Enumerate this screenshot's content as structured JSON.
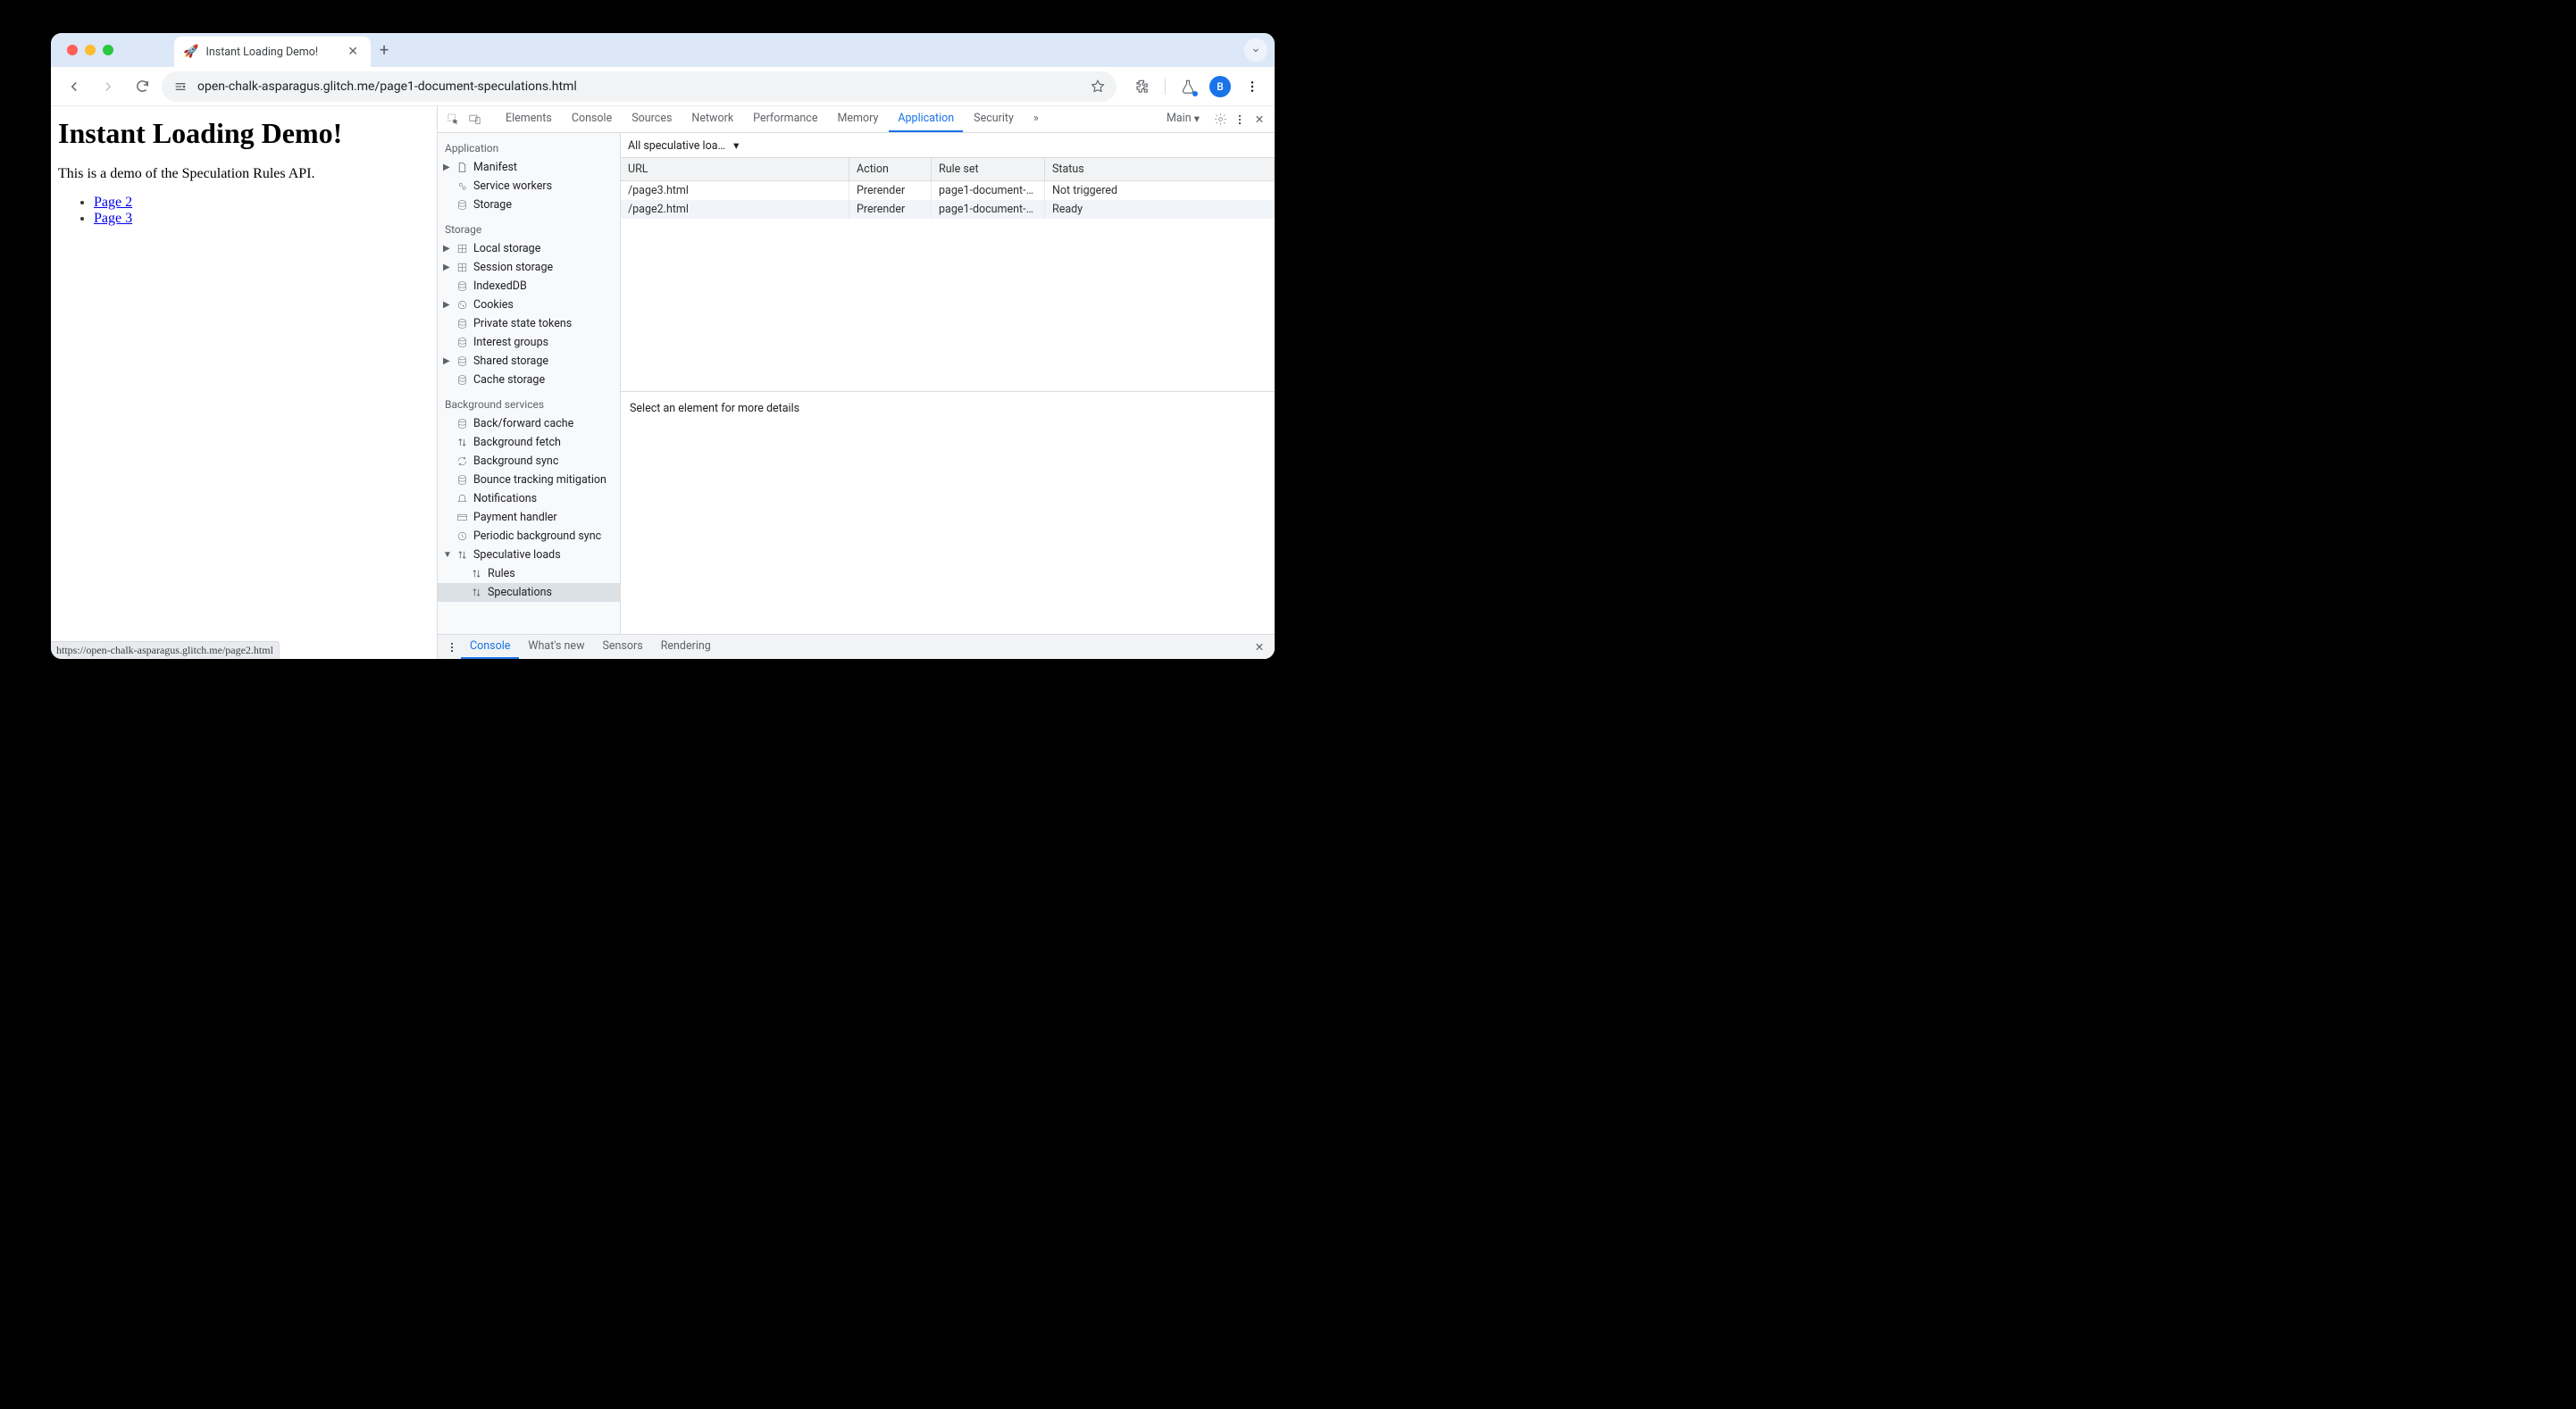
{
  "browser": {
    "tab": {
      "favicon": "🚀",
      "title": "Instant Loading Demo!"
    },
    "url": "open-chalk-asparagus.glitch.me/page1-document-speculations.html",
    "avatar_initial": "B",
    "status_hover": "https://open-chalk-asparagus.glitch.me/page2.html"
  },
  "page": {
    "heading": "Instant Loading Demo!",
    "intro": "This is a demo of the Speculation Rules API.",
    "links": [
      "Page 2",
      "Page 3"
    ]
  },
  "devtools": {
    "tabs": [
      "Elements",
      "Console",
      "Sources",
      "Network",
      "Performance",
      "Memory",
      "Application",
      "Security"
    ],
    "active_tab": "Application",
    "target_label": "Main",
    "sidebar": {
      "sections": [
        {
          "title": "Application",
          "items": [
            {
              "icon": "file",
              "label": "Manifest",
              "chev": true
            },
            {
              "icon": "gears",
              "label": "Service workers"
            },
            {
              "icon": "db",
              "label": "Storage"
            }
          ]
        },
        {
          "title": "Storage",
          "items": [
            {
              "icon": "grid",
              "label": "Local storage",
              "chev": true
            },
            {
              "icon": "grid",
              "label": "Session storage",
              "chev": true
            },
            {
              "icon": "db",
              "label": "IndexedDB"
            },
            {
              "icon": "cookie",
              "label": "Cookies",
              "chev": true
            },
            {
              "icon": "db",
              "label": "Private state tokens"
            },
            {
              "icon": "db",
              "label": "Interest groups"
            },
            {
              "icon": "db",
              "label": "Shared storage",
              "chev": true
            },
            {
              "icon": "db",
              "label": "Cache storage"
            }
          ]
        },
        {
          "title": "Background services",
          "items": [
            {
              "icon": "db",
              "label": "Back/forward cache"
            },
            {
              "icon": "arrows",
              "label": "Background fetch"
            },
            {
              "icon": "sync",
              "label": "Background sync"
            },
            {
              "icon": "db",
              "label": "Bounce tracking mitigation"
            },
            {
              "icon": "bell",
              "label": "Notifications"
            },
            {
              "icon": "card",
              "label": "Payment handler"
            },
            {
              "icon": "clock",
              "label": "Periodic background sync"
            },
            {
              "icon": "arrows",
              "label": "Speculative loads",
              "chev": true,
              "open": true,
              "children": [
                {
                  "icon": "arrows",
                  "label": "Rules"
                },
                {
                  "icon": "arrows",
                  "label": "Speculations",
                  "selected": true
                }
              ]
            }
          ]
        }
      ]
    },
    "filter": "All speculative loa…",
    "table": {
      "headers": [
        "URL",
        "Action",
        "Rule set",
        "Status"
      ],
      "rows": [
        {
          "url": "/page3.html",
          "action": "Prerender",
          "rule": "page1-document-…",
          "status": "Not triggered"
        },
        {
          "url": "/page2.html",
          "action": "Prerender",
          "rule": "page1-document-…",
          "status": "Ready"
        }
      ]
    },
    "detail_hint": "Select an element for more details",
    "console_tabs": [
      "Console",
      "What's new",
      "Sensors",
      "Rendering"
    ],
    "console_active": "Console"
  }
}
